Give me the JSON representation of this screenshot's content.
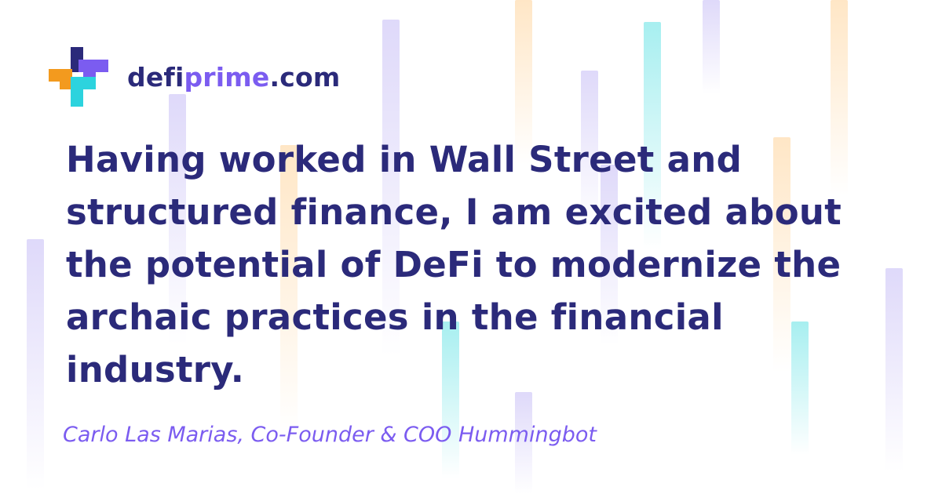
{
  "brand": {
    "name_prefix": "defi",
    "name_main": "prime",
    "name_suffix": ".com",
    "colors": {
      "navy": "#2b2a7a",
      "purple": "#7b5cf0",
      "orange": "#f39a1e",
      "cyan": "#2cd3de"
    },
    "logo_icon": "pixel-cross-logo-icon"
  },
  "quote": {
    "text": "Having worked in Wall Street and structured finance, I am excited about the potential of DeFi to modernize the archaic practices in the financial industry."
  },
  "attribution": {
    "text": "Carlo Las Marias, Co-Founder & COO Hummingbot"
  }
}
